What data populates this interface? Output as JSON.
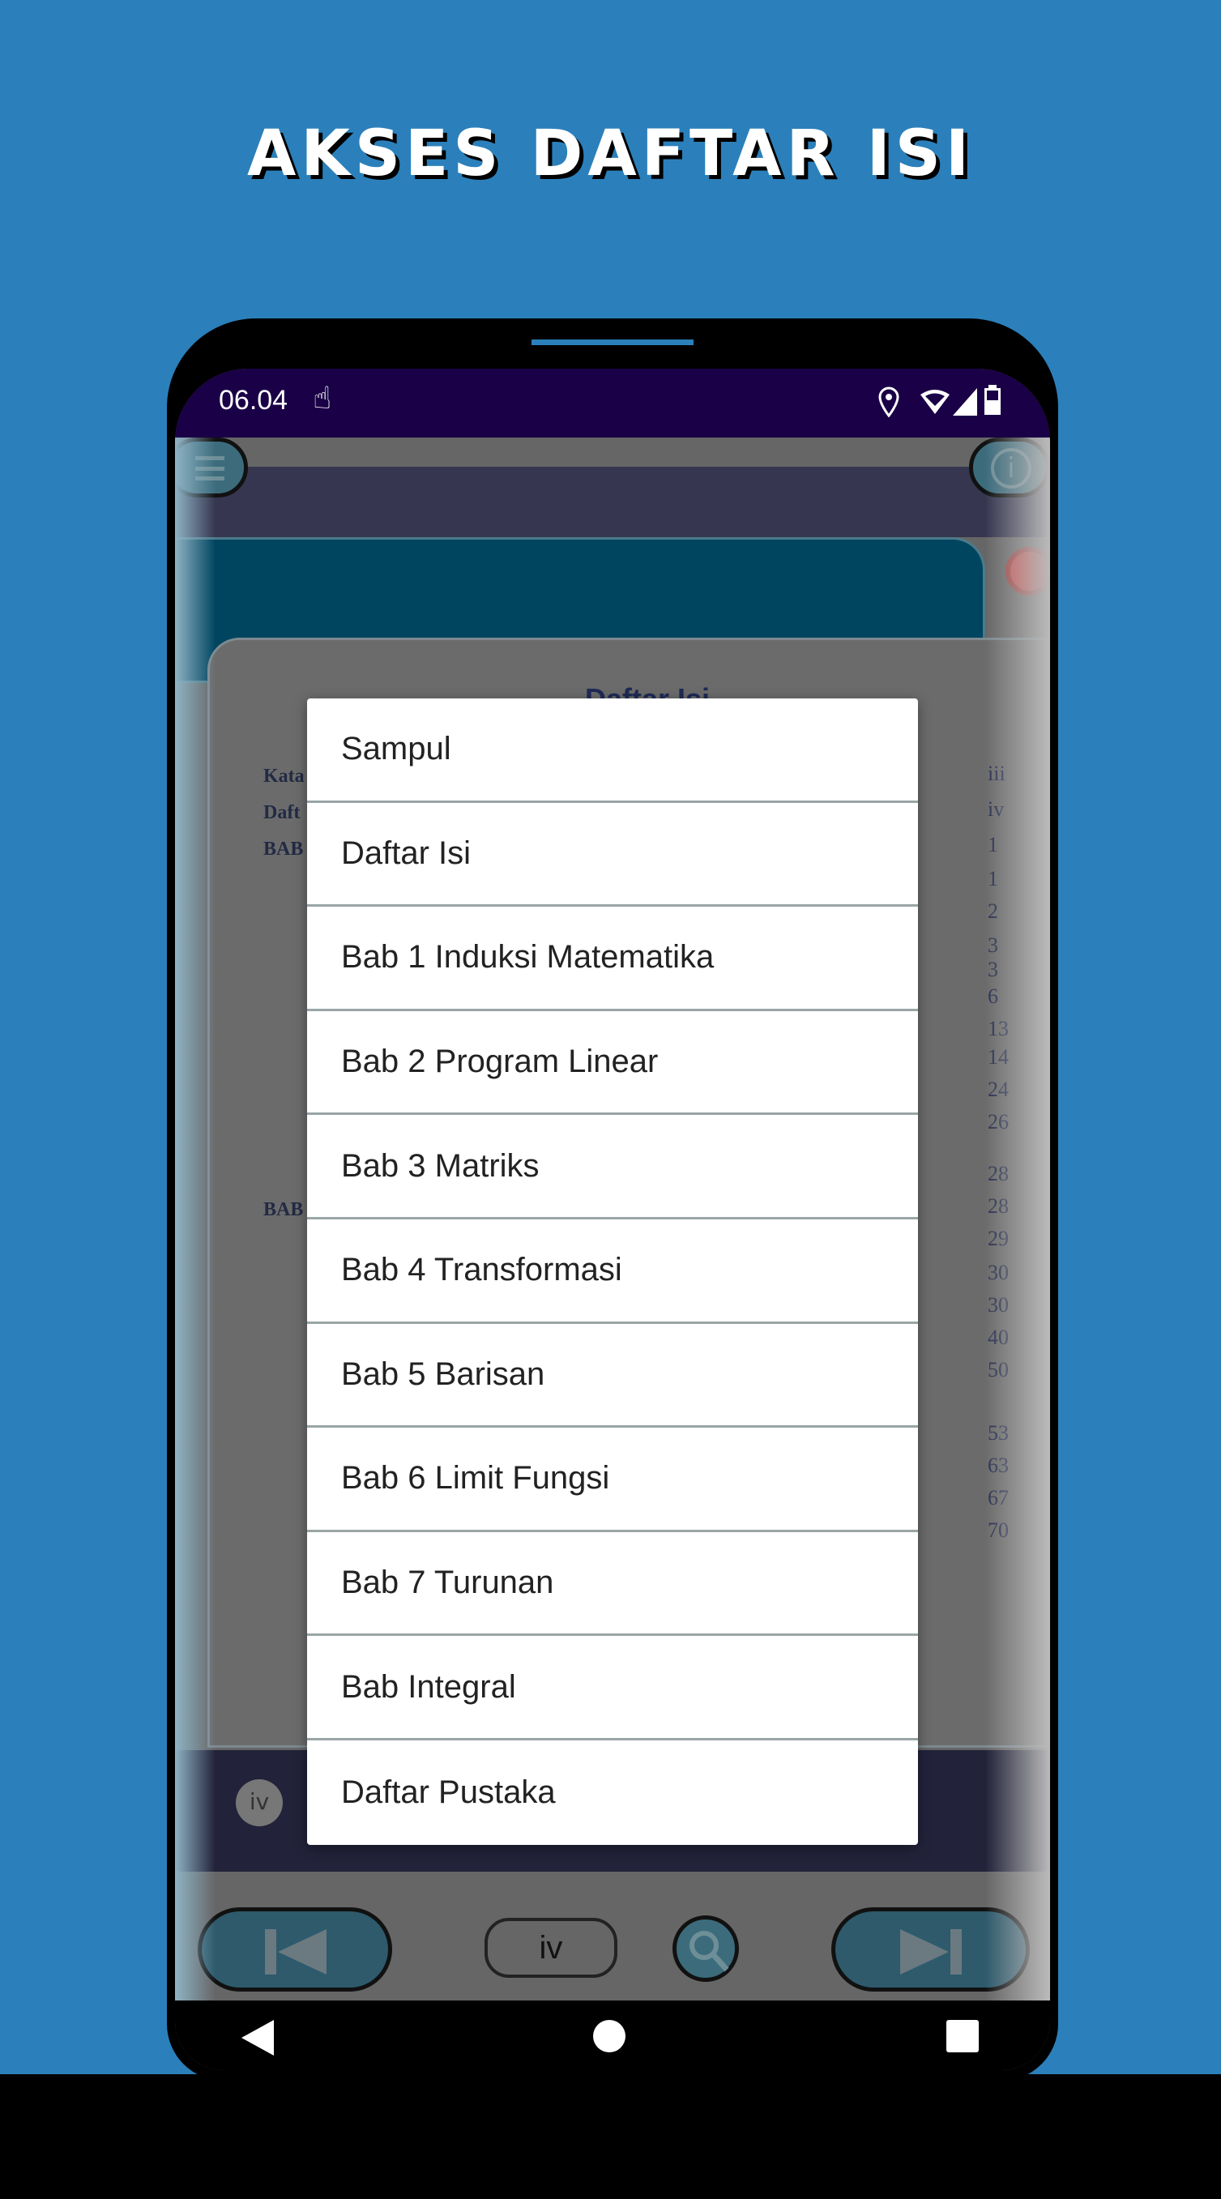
{
  "heading": "AKSES DAFTAR ISI",
  "status_bar": {
    "time": "06.04",
    "icons": [
      "hand-pointer-icon",
      "location-icon",
      "wifi-icon",
      "signal-icon",
      "battery-icon"
    ]
  },
  "background_page": {
    "title": "Daftar Isi",
    "left_labels": [
      "Kata",
      "Daft",
      "BAB",
      "BAB"
    ],
    "page_numbers": [
      "iii",
      "iv",
      "1",
      "1",
      "2",
      "3",
      "3",
      "6",
      "13",
      "14",
      "24",
      "26",
      "28",
      "28",
      "29",
      "30",
      "30",
      "40",
      "50",
      "53",
      "63",
      "67",
      "70"
    ],
    "footer_page_badge": "iv"
  },
  "toolbar": {
    "page_indicator": "iv"
  },
  "dialog": {
    "items": [
      "Sampul",
      "Daftar Isi",
      "Bab 1 Induksi Matematika",
      "Bab 2 Program Linear",
      "Bab 3 Matriks",
      "Bab 4 Transformasi",
      "Bab 5 Barisan",
      "Bab 6 Limit Fungsi",
      "Bab 7 Turunan",
      "Bab Integral",
      "Daftar Pustaka"
    ]
  },
  "colors": {
    "background": "#2b80bb",
    "status_bar": "#1a0046",
    "dialog": "#ffffff"
  }
}
